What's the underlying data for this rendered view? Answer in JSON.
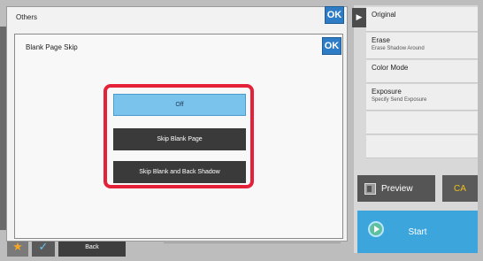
{
  "right_panel": {
    "items": [
      {
        "title": "Original",
        "subtitle": ""
      },
      {
        "title": "Erase",
        "subtitle": "Erase Shadow Around"
      },
      {
        "title": "Color Mode",
        "subtitle": ""
      },
      {
        "title": "Exposure",
        "subtitle": "Specify Send Exposure"
      }
    ],
    "preview_label": "Preview",
    "ca_label": "CA",
    "start_label": "Start"
  },
  "others_dialog": {
    "title": "Others",
    "ok_label": "OK"
  },
  "blank_page_skip": {
    "title": "Blank Page Skip",
    "ok_label": "OK",
    "options": [
      {
        "label": "Off",
        "selected": true
      },
      {
        "label": "Skip Blank Page",
        "selected": false
      },
      {
        "label": "Skip Blank and Back Shadow",
        "selected": false
      }
    ]
  },
  "bottom_bar": {
    "back_label": "Back"
  },
  "colors": {
    "accent_blue": "#2e7bc6",
    "selected_option": "#7ac3ed",
    "highlight_red": "#e5213a",
    "start_blue": "#3ba5dc",
    "ca_yellow": "#f0c018"
  }
}
